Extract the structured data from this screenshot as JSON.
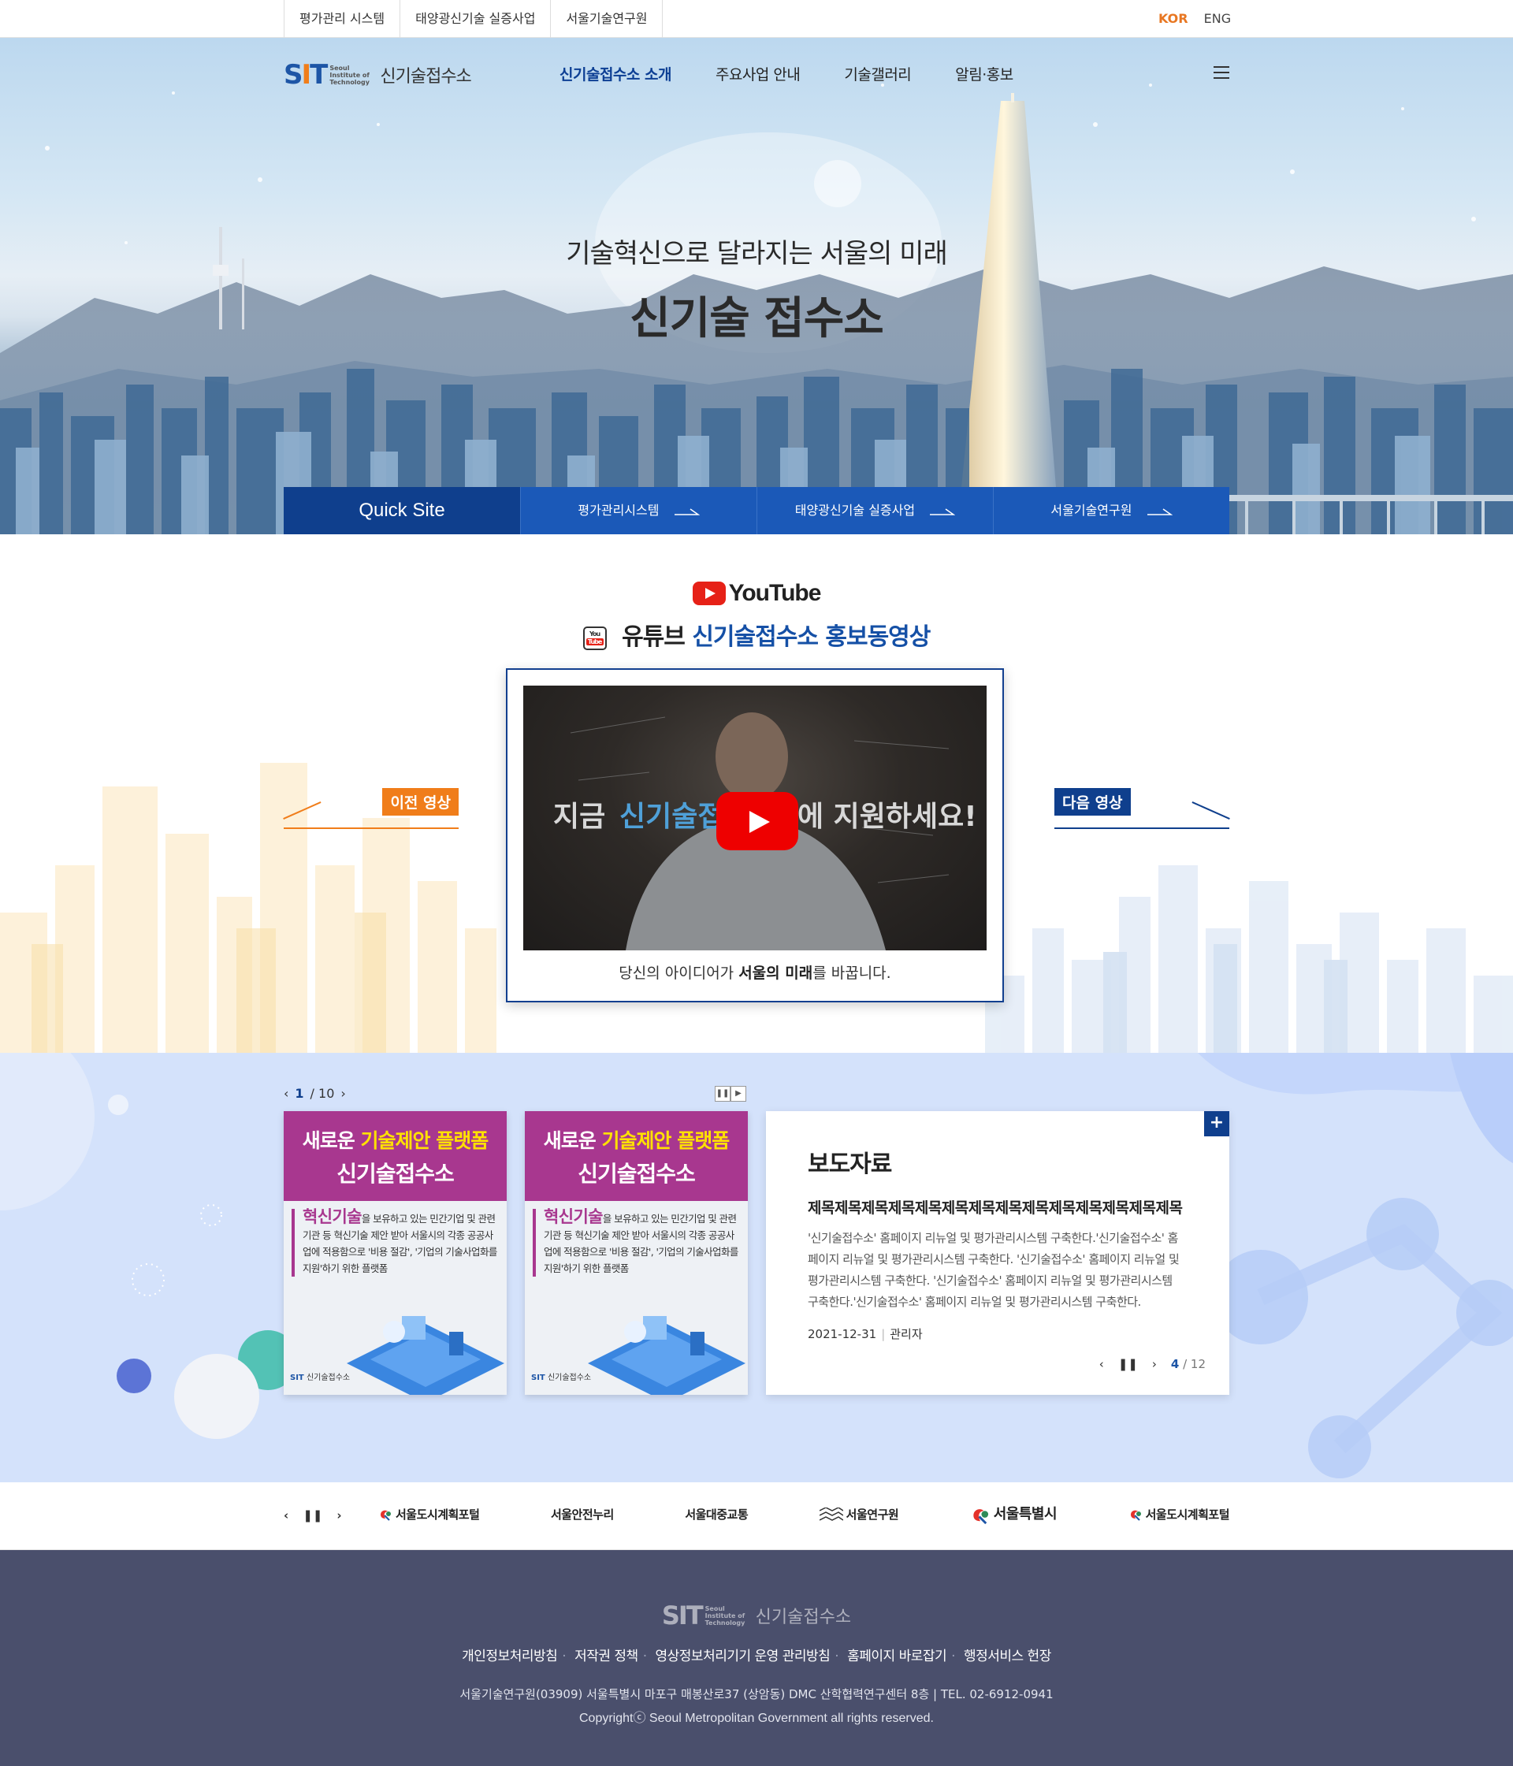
{
  "util": {
    "links": [
      "평가관리 시스템",
      "태양광신기술 실증사업",
      "서울기술연구원"
    ],
    "lang_active": "KOR",
    "lang_other": "ENG"
  },
  "header": {
    "logo_mark": "SIT",
    "logo_sub": "Seoul Institute of Technology",
    "logo_name": "신기술접수소",
    "menu": [
      "신기술접수소 소개",
      "주요사업 안내",
      "기술갤러리",
      "알림·홍보"
    ]
  },
  "hero": {
    "title_line1": "기술혁신으로 달라지는 서울의 미래",
    "title_line2": "신기술 접수소"
  },
  "quick": {
    "title": "Quick Site",
    "items": [
      "평가관리시스템",
      "태양광신기술 실증사업",
      "서울기술연구원"
    ]
  },
  "youtube": {
    "brand": "YouTube",
    "mini_top": "You",
    "mini_bottom": "Tube",
    "title_a": "유튜브",
    "title_b": "신기술접수소 홍보동영상",
    "video_overlay_a": "지금",
    "video_overlay_b": "신기술접",
    "video_overlay_c": "에 지원하세요!",
    "caption_a": "당신의 아이디어가 ",
    "caption_b": "서울의 미래",
    "caption_c": "를 바꿉니다.",
    "prev": "이전 영상",
    "next": "다음 영상"
  },
  "news": {
    "pager_current": "1",
    "pager_total": "/ 10",
    "card": {
      "line1_a": "새로운 ",
      "line1_b": "기술제안 플랫폼",
      "line2": "신기술접수소",
      "body_strong": "혁신기술",
      "body_rest": "을 보유하고 있는 민간기업 및 관련기관 등 혁신기술 제안 받아 서울시의 각종 공공사업에 적용함으로 '비용 절감', '기업의 기술사업화를 지원'하기 위한 플랫폼",
      "foot_mark": "SIT",
      "foot_name": "신기술접수소"
    },
    "press": {
      "title": "보도자료",
      "subject": "제목제목제목제목제목제목제목제목제목제목제목제목제목제목",
      "desc": "'신기술접수소' 홈페이지 리뉴얼 및 평가관리시스템 구축한다.'신기술접수소' 홈페이지 리뉴얼 및 평가관리시스템 구축한다. '신기술접수소' 홈페이지 리뉴얼 및 평가관리시스템 구축한다. '신기술접수소' 홈페이지 리뉴얼 및 평가관리시스템 구축한다.'신기술접수소' 홈페이지 리뉴얼 및 평가관리시스템 구축한다.",
      "date": "2021-12-31",
      "author": "관리자",
      "page_current": "4",
      "page_total": "12"
    }
  },
  "banner": {
    "items": [
      "서울도시계획포털",
      "서울안전누리",
      "서울대중교통",
      "서울연구원",
      "서울특별시",
      "서울도시계획포털"
    ]
  },
  "footer": {
    "logo_mark": "SIT",
    "logo_sub": "Seoul Institute of Technology",
    "logo_name": "신기술접수소",
    "links": [
      "개인정보처리방침",
      "저작권 정책",
      "영상정보처리기기 운영 관리방침",
      "홈페이지 바로잡기",
      "행정서비스 헌장"
    ],
    "address": "서울기술연구원(03909) 서울특별시 마포구 매봉산로37 (상암동) DMC 산학협력연구센터 8층 | TEL. 02-6912-0941",
    "copyright": "Copyrightⓒ Seoul Metropolitan Government all rights reserved."
  },
  "colors": {
    "primary": "#0f3f8d",
    "accent": "#f07d1a",
    "footer_bg": "#4a4f6c",
    "news_bg": "#d4e2fb"
  }
}
